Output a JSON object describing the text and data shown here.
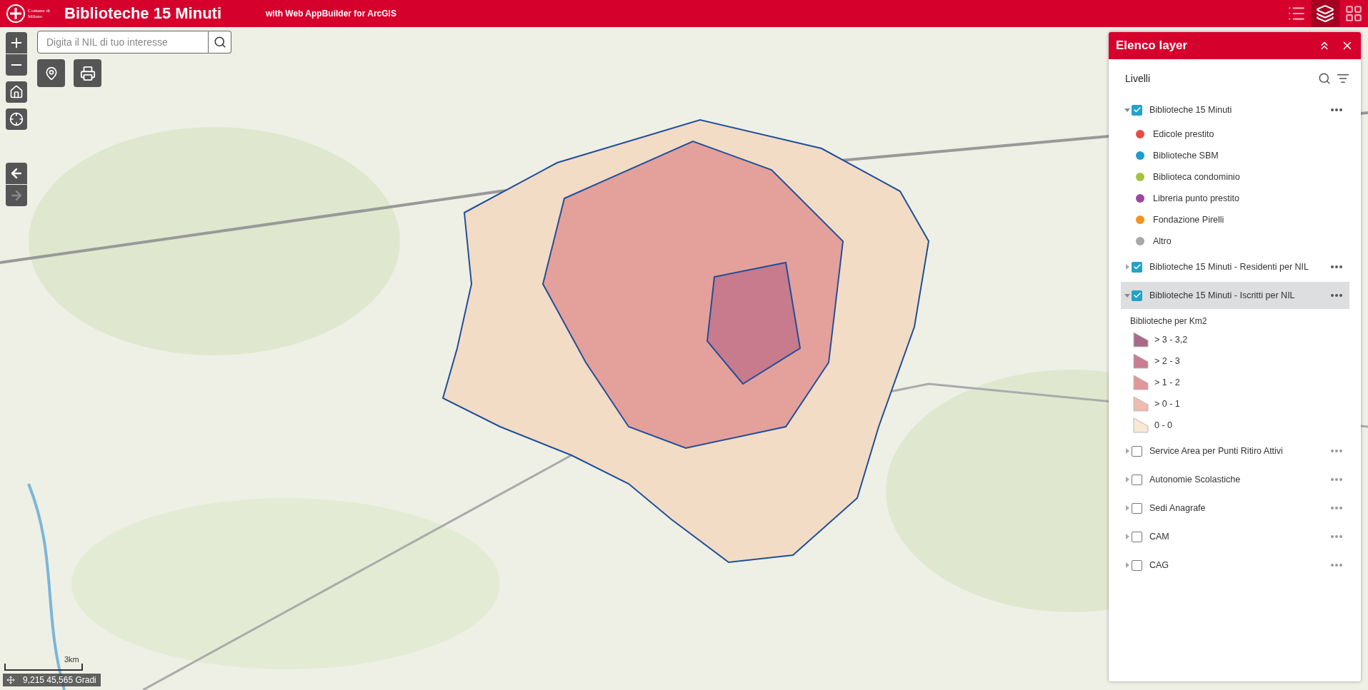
{
  "header": {
    "logo_text": "Comune di Milano",
    "title": "Biblioteche 15 Minuti",
    "subtitle": "with Web AppBuilder for ArcGIS",
    "tools": [
      {
        "kind": "legend",
        "selected": false
      },
      {
        "kind": "layers",
        "selected": true
      },
      {
        "kind": "grid",
        "selected": false
      }
    ]
  },
  "search": {
    "placeholder": "Digita il NIL di tuo interesse"
  },
  "navigation": [
    {
      "kind": "back",
      "disabled": false
    },
    {
      "kind": "forward",
      "disabled": true
    }
  ],
  "map": {
    "scale_label": "3km",
    "coordinates": "9,215 45,565 Gradi"
  },
  "panel": {
    "title": "Elenco layer",
    "section": "Livelli",
    "layers": [
      {
        "name": "Biblioteche 15 Minuti",
        "checked": true,
        "expanded": true,
        "selected": false,
        "legend": [
          {
            "kind": "point",
            "label": "Edicole prestito",
            "color": "#e84a4a"
          },
          {
            "kind": "point",
            "label": "Biblioteche SBM",
            "color": "#1f9bd2"
          },
          {
            "kind": "point",
            "label": "Biblioteca condominio",
            "color": "#a4c43a"
          },
          {
            "kind": "point",
            "label": "Libreria punto prestito",
            "color": "#9a4a9e"
          },
          {
            "kind": "point",
            "label": "Fondazione Pirelli",
            "color": "#f7931e"
          },
          {
            "kind": "point",
            "label": "Altro",
            "color": "#a8a8a8"
          }
        ]
      },
      {
        "name": "Biblioteche 15 Minuti - Residenti per NIL",
        "checked": true,
        "expanded": false,
        "selected": false
      },
      {
        "name": "Biblioteche 15 Minuti - Iscritti per NIL",
        "checked": true,
        "expanded": true,
        "selected": true,
        "legend_title": "Biblioteche per Km2",
        "legend": [
          {
            "kind": "polygon",
            "label": "> 3 - 3,2",
            "color": "#a86a88"
          },
          {
            "kind": "polygon",
            "label": "> 2 - 3",
            "color": "#c87d90"
          },
          {
            "kind": "polygon",
            "label": "> 1 - 2",
            "color": "#e0979a"
          },
          {
            "kind": "polygon",
            "label": "> 0 - 1",
            "color": "#eebbb0"
          },
          {
            "kind": "polygon",
            "label": "0 - 0",
            "color": "#f8e8d4"
          }
        ]
      },
      {
        "name": "Service Area per Punti Ritiro Attivi",
        "checked": false,
        "expanded": false,
        "selected": false
      },
      {
        "name": "Autonomie Scolastiche",
        "checked": false,
        "expanded": false,
        "selected": false
      },
      {
        "name": "Sedi Anagrafe",
        "checked": false,
        "expanded": false,
        "selected": false
      },
      {
        "name": "CAM",
        "checked": false,
        "expanded": false,
        "selected": false
      },
      {
        "name": "CAG",
        "checked": false,
        "expanded": false,
        "selected": false
      }
    ]
  }
}
